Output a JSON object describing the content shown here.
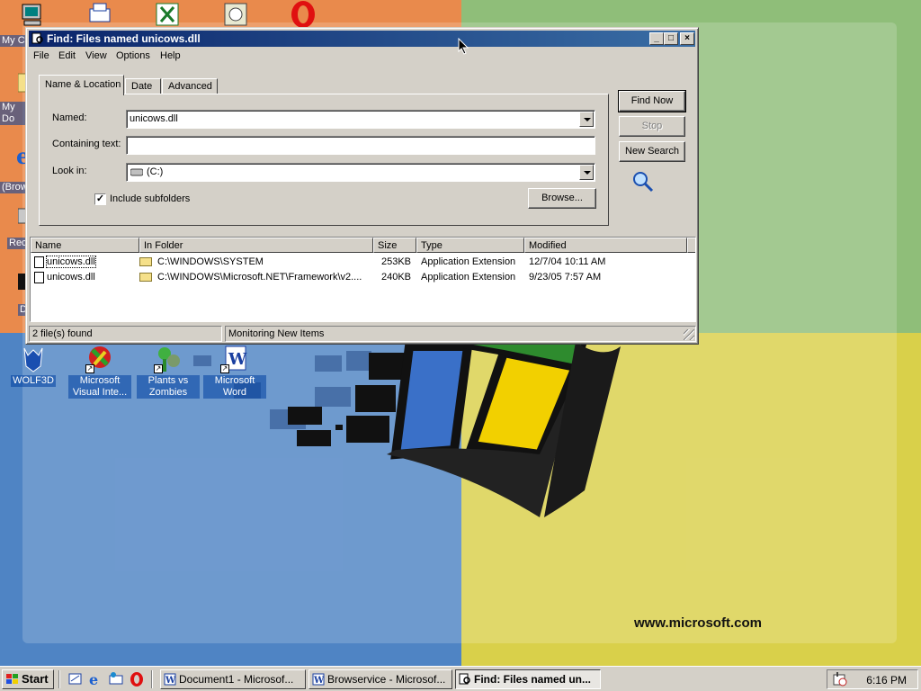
{
  "wallpaper": {
    "url_text": "www.microsoft.com"
  },
  "desktop_icons": [
    {
      "label": "My C",
      "icon": "my-computer-icon"
    },
    {
      "label": "My Do",
      "icon": "my-documents-icon"
    },
    {
      "label": "(Brow",
      "icon": "internet-explorer-icon"
    },
    {
      "label": "Rec",
      "icon": "recycle-bin-icon"
    },
    {
      "label": "D",
      "icon": "dos-icon"
    },
    {
      "label": "WOLF3D",
      "icon": "wolf3d-icon"
    },
    {
      "label": "Microsoft Visual Inte...",
      "icon": "visual-interdev-icon"
    },
    {
      "label": "Plants vs Zombies",
      "icon": "plants-vs-zombies-icon"
    },
    {
      "label": "Microsoft Word",
      "icon": "word-icon"
    }
  ],
  "window": {
    "title": "Find: Files named unicows.dll",
    "menu": [
      "File",
      "Edit",
      "View",
      "Options",
      "Help"
    ],
    "tabs": [
      "Name & Location",
      "Date",
      "Advanced"
    ],
    "fields": {
      "named_label": "Named:",
      "named_value": "unicows.dll",
      "containing_label": "Containing text:",
      "containing_value": "",
      "lookin_label": "Look in:",
      "lookin_value": "(C:)",
      "subfolders_label": "Include subfolders",
      "subfolders_checked": true
    },
    "buttons": {
      "find_now": "Find Now",
      "stop": "Stop",
      "new_search": "New Search",
      "browse": "Browse..."
    },
    "columns": [
      "Name",
      "In Folder",
      "Size",
      "Type",
      "Modified"
    ],
    "rows": [
      {
        "name": "unicows.dll",
        "folder": "C:\\WINDOWS\\SYSTEM",
        "size": "253KB",
        "type": "Application Extension",
        "modified": "12/7/04 10:11 AM"
      },
      {
        "name": "unicows.dll",
        "folder": "C:\\WINDOWS\\Microsoft.NET\\Framework\\v2....",
        "size": "240KB",
        "type": "Application Extension",
        "modified": "9/23/05 7:57 AM"
      }
    ],
    "status": {
      "found": "2 file(s) found",
      "monitoring": "Monitoring New Items"
    }
  },
  "taskbar": {
    "start_label": "Start",
    "tasks": [
      {
        "label": "Document1 - Microsof...",
        "active": false
      },
      {
        "label": "Browservice - Microsof...",
        "active": false
      },
      {
        "label": "Find: Files named un...",
        "active": true
      }
    ],
    "clock": "6:16 PM"
  },
  "colors": {
    "title_active_start": "#0a246a",
    "title_active_end": "#3a6ea5",
    "face": "#d4d0c8"
  }
}
